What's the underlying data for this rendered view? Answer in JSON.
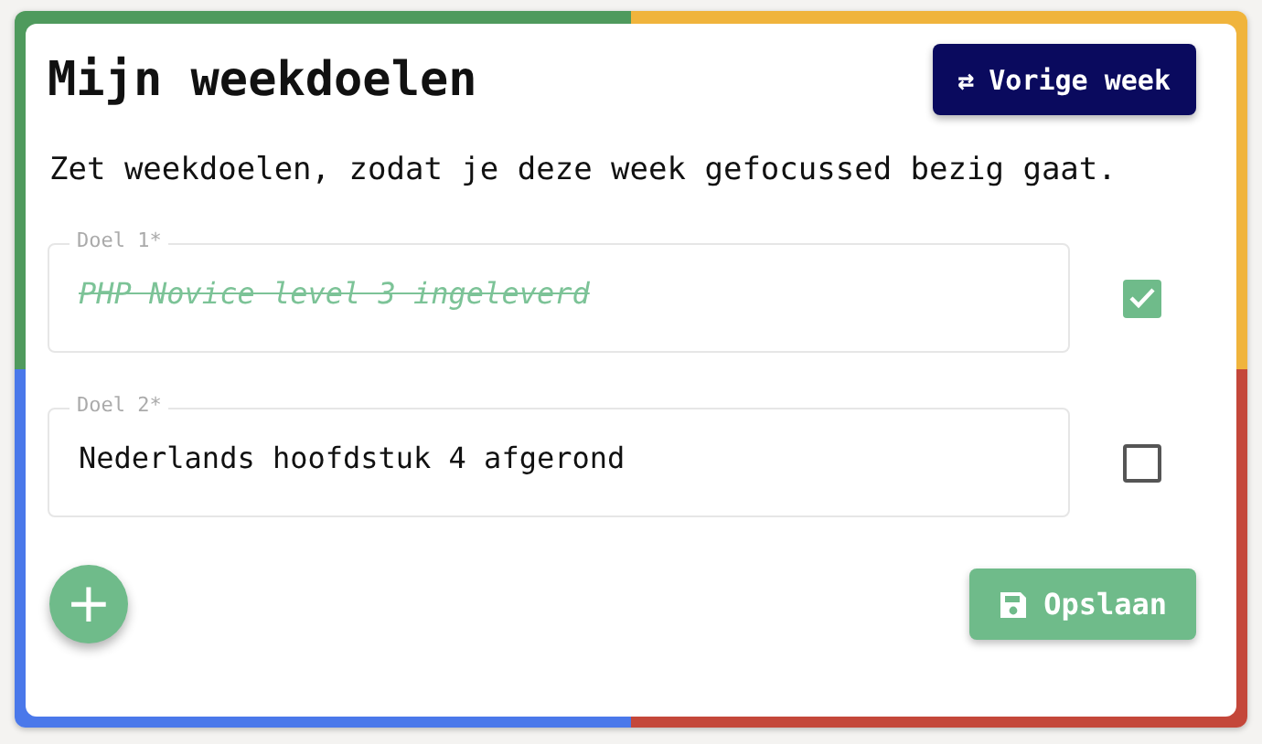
{
  "title": "Mijn weekdoelen",
  "previous_week_button": {
    "icon": "⇄",
    "label": "Vorige week"
  },
  "description": "Zet weekdoelen, zodat je deze week gefocussed bezig gaat.",
  "goals": [
    {
      "label": "Doel 1*",
      "value": "PHP Novice level 3 ingeleverd",
      "checked": true
    },
    {
      "label": "Doel 2*",
      "value": "Nederlands hoofdstuk 4 afgerond",
      "checked": false
    }
  ],
  "add_button": {
    "label": "+"
  },
  "save_button": {
    "label": "Opslaan"
  }
}
